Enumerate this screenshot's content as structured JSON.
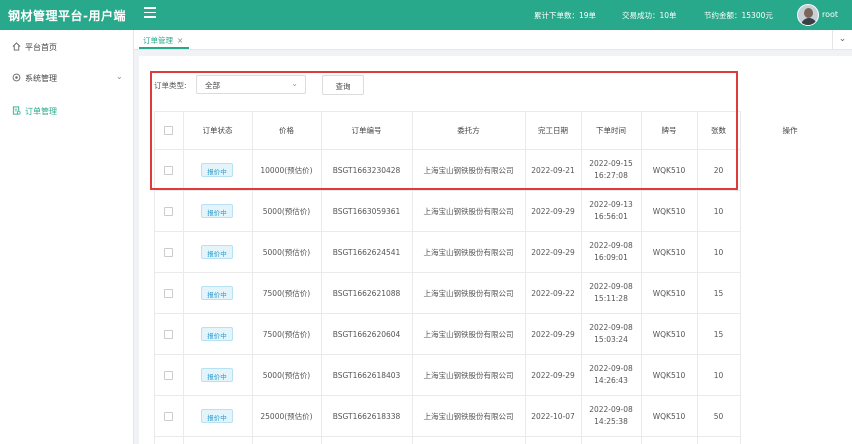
{
  "header": {
    "brand": "钢材管理平台-用户端",
    "stats": [
      "累计下单数：19单",
      "交易成功：10单",
      "节约金额：15300元"
    ],
    "user_name": "root"
  },
  "sidebar": {
    "items": [
      {
        "label": "平台首页",
        "icon": "home-icon"
      },
      {
        "label": "系统管理",
        "icon": "gear-icon"
      },
      {
        "label": "订单管理",
        "icon": "order-icon"
      }
    ]
  },
  "tabs": [
    {
      "label": "订单管理",
      "close": "×"
    }
  ],
  "filter": {
    "label": "订单类型:",
    "select_value": "全部",
    "query_label": "查询"
  },
  "table": {
    "headers": [
      "订单状态",
      "价格",
      "订单编号",
      "委托方",
      "完工日期",
      "下单时间",
      "牌号",
      "张数",
      "操作"
    ],
    "rows": [
      {
        "status": "报价中",
        "price": "10000(预估价)",
        "order_no": "BSGT1663230428",
        "client": "上海宝山钢铁股份有限公司",
        "finish_date": "2022-09-21",
        "order_date": "2022-09-15",
        "order_time": "16:27:08",
        "grade": "WQK510",
        "sheets": "20"
      },
      {
        "status": "报价中",
        "price": "5000(预估价)",
        "order_no": "BSGT1663059361",
        "client": "上海宝山钢铁股份有限公司",
        "finish_date": "2022-09-29",
        "order_date": "2022-09-13",
        "order_time": "16:56:01",
        "grade": "WQK510",
        "sheets": "10"
      },
      {
        "status": "报价中",
        "price": "5000(预估价)",
        "order_no": "BSGT1662624541",
        "client": "上海宝山钢铁股份有限公司",
        "finish_date": "2022-09-29",
        "order_date": "2022-09-08",
        "order_time": "16:09:01",
        "grade": "WQK510",
        "sheets": "10"
      },
      {
        "status": "报价中",
        "price": "7500(预估价)",
        "order_no": "BSGT1662621088",
        "client": "上海宝山钢铁股份有限公司",
        "finish_date": "2022-09-22",
        "order_date": "2022-09-08",
        "order_time": "15:11:28",
        "grade": "WQK510",
        "sheets": "15"
      },
      {
        "status": "报价中",
        "price": "7500(预估价)",
        "order_no": "BSGT1662620604",
        "client": "上海宝山钢铁股份有限公司",
        "finish_date": "2022-09-29",
        "order_date": "2022-09-08",
        "order_time": "15:03:24",
        "grade": "WQK510",
        "sheets": "15"
      },
      {
        "status": "报价中",
        "price": "5000(预估价)",
        "order_no": "BSGT1662618403",
        "client": "上海宝山钢铁股份有限公司",
        "finish_date": "2022-09-29",
        "order_date": "2022-09-08",
        "order_time": "14:26:43",
        "grade": "WQK510",
        "sheets": "10"
      },
      {
        "status": "报价中",
        "price": "25000(预估价)",
        "order_no": "BSGT1662618338",
        "client": "上海宝山钢铁股份有限公司",
        "finish_date": "2022-10-07",
        "order_date": "2022-09-08",
        "order_time": "14:25:38",
        "grade": "WQK510",
        "sheets": "50"
      }
    ]
  },
  "colors": {
    "header": "#29a98b",
    "highlight": "#e03b3b",
    "badge": "#2c99c9"
  }
}
